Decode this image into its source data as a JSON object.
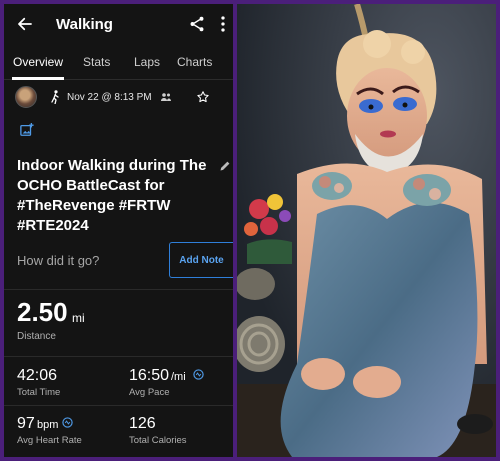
{
  "app": {
    "title": "Walking",
    "tabs": [
      {
        "label": "Overview",
        "active": true
      },
      {
        "label": "Stats",
        "active": false
      },
      {
        "label": "Laps",
        "active": false
      },
      {
        "label": "Charts",
        "active": false
      }
    ]
  },
  "activity": {
    "datetime": "Nov 22 @ 8:13 PM",
    "title": "Indoor Walking during The OCHO BattleCast for #TheRevenge #FRTW #RTE2024",
    "prompt": "How did it go?",
    "add_note_label": "Add Note"
  },
  "stats": {
    "distance": {
      "value": "2.50",
      "unit": "mi",
      "label": "Distance"
    },
    "total_time": {
      "value": "42:06",
      "label": "Total Time"
    },
    "avg_pace": {
      "value": "16:50",
      "unit": "/mi",
      "label": "Avg Pace"
    },
    "avg_heart_rate": {
      "value": "97",
      "unit": "bpm",
      "label": "Avg Heart Rate"
    },
    "total_calories": {
      "value": "126",
      "label": "Total Calories"
    }
  },
  "colors": {
    "frame": "#4b1f7a",
    "app_background": "#141414",
    "accent_blue": "#2f7fd9"
  },
  "icons": [
    "back-arrow-icon",
    "share-icon",
    "more-vert-icon",
    "walk-icon",
    "people-icon",
    "star-icon",
    "add-photo-icon",
    "edit-icon",
    "info-icon"
  ]
}
